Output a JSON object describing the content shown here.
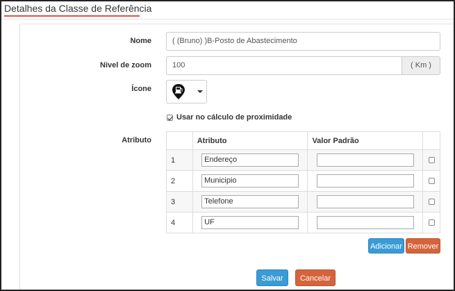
{
  "header": {
    "title": "Detalhes da Classe de Referência"
  },
  "form": {
    "nome_label": "Nome",
    "nome_value": "( (Bruno) )B-Posto de Abastecimento",
    "zoom_label": "Nivel de zoom",
    "zoom_value": "100",
    "zoom_unit": "( Km )",
    "icone_label": "Ícone",
    "icone_icon": "fuel-pump-map-pin-icon",
    "proximity_label": "Usar no cálculo de proximidade",
    "proximity_checked": true,
    "atributo_label": "Atributo"
  },
  "table": {
    "headers": [
      "",
      "Atributo",
      "Valor Padrão",
      ""
    ],
    "rows": [
      {
        "num": "1",
        "atributo": "Endereço",
        "valor": ""
      },
      {
        "num": "2",
        "atributo": "Municipio",
        "valor": ""
      },
      {
        "num": "3",
        "atributo": "Telefone",
        "valor": ""
      },
      {
        "num": "4",
        "atributo": "UF",
        "valor": ""
      }
    ]
  },
  "buttons": {
    "adicionar": "Adicionar",
    "remover": "Remover",
    "salvar": "Salvar",
    "cancelar": "Cancelar"
  },
  "colors": {
    "accent_blue": "#3a9bd5",
    "accent_orange": "#d4643c",
    "title_underline": "#d9534f"
  }
}
